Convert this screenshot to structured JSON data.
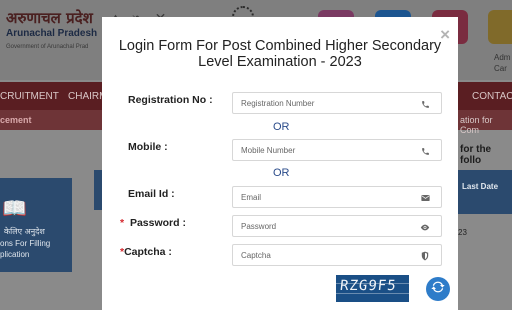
{
  "background": {
    "hindi_title": "अरुणाचल प्रदेश",
    "english_title": "Arunachal Pradesh",
    "government": "Government of Arunachal Prad",
    "admit_text_1": "Adm",
    "admit_text_2": "Car",
    "nav_left": "CRUITMENT",
    "nav_left_2": "CHAIRM",
    "nav_right": "CONTACT",
    "ticker_left": "cement",
    "ticker_right": "ation for Com",
    "info_text": "for the follo",
    "card_hindi": "केलिए अनुदेश",
    "card_line_2": "ons For Filling",
    "card_line_3": "plication",
    "table_header": "Last Date",
    "table_value": "23"
  },
  "modal": {
    "title_line_1": "Login Form For Post Combined Higher Secondary",
    "title_line_2": "Level Examination - 2023",
    "close_label": "×",
    "or_text": "OR",
    "registration": {
      "label": "Registration No :",
      "placeholder": "Registration Number",
      "icon": "phone-icon"
    },
    "mobile": {
      "label": "Mobile :",
      "placeholder": "Mobile Number",
      "icon": "phone-icon"
    },
    "email": {
      "label": "Email Id :",
      "placeholder": "Email",
      "icon": "envelope-icon"
    },
    "password": {
      "required_mark": "*",
      "label": "Password :",
      "placeholder": "Password",
      "icon": "eye-icon"
    },
    "captcha": {
      "required_mark": "*",
      "label": "Captcha :",
      "placeholder": "Captcha",
      "icon": "shield-icon",
      "image_text": "RZG9F5",
      "refresh_icon": "refresh-icon"
    }
  },
  "colors": {
    "overlay_nav": "#5a1e22",
    "captcha_bg": "#1a4f86",
    "refresh_bg": "#2e7cc9",
    "required": "#d4282e",
    "or_text": "#2a4b8a"
  }
}
